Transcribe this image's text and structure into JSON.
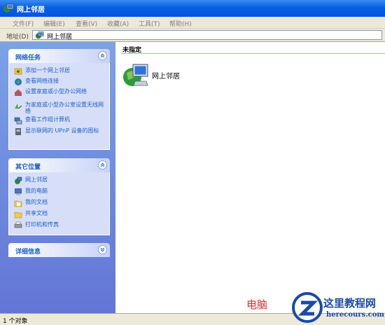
{
  "window": {
    "title": "网上邻居"
  },
  "menu": [
    "文件(F)",
    "编辑(E)",
    "查看(V)",
    "收藏(A)",
    "工具(T)",
    "帮助(H)"
  ],
  "address": {
    "label": "地址(D)",
    "value": "网上邻居"
  },
  "tasks_panel": {
    "title": "网络任务",
    "items": [
      {
        "label": "添加一个网上邻居",
        "icon": "add-network-place-icon"
      },
      {
        "label": "查看网络连接",
        "icon": "network-connections-icon"
      },
      {
        "label": "设置家庭或小型办公网络",
        "icon": "home-network-setup-icon"
      },
      {
        "label": "为家庭或小型办公室设置无线网络",
        "icon": "wireless-network-icon"
      },
      {
        "label": "查看工作组计算机",
        "icon": "workgroup-computers-icon"
      },
      {
        "label": "显示联网的 UPnP 设备的图标",
        "icon": "upnp-devices-icon"
      }
    ]
  },
  "places_panel": {
    "title": "其它位置",
    "items": [
      {
        "label": "网上邻居",
        "icon": "network-places-icon"
      },
      {
        "label": "我的电脑",
        "icon": "my-computer-icon"
      },
      {
        "label": "我的文档",
        "icon": "my-documents-icon"
      },
      {
        "label": "共享文档",
        "icon": "shared-documents-icon"
      },
      {
        "label": "打印机和传真",
        "icon": "printers-faxes-icon"
      }
    ]
  },
  "details_panel": {
    "title": "详细信息"
  },
  "content": {
    "group_header": "未指定",
    "items": [
      {
        "label": "网上邻居",
        "icon": "network-places-icon"
      }
    ]
  },
  "status": {
    "text": "1 个对象"
  },
  "watermark": {
    "text": "电脑",
    "site_cn": "这里教程网",
    "site_en": "herecours.com"
  },
  "colors": {
    "title_bar": "#0054e3",
    "left_pane": "#6b8ede",
    "panel_body": "#d6dff7",
    "link": "#215dc6",
    "watermark_red": "#e0282a",
    "watermark_blue": "#1a4aa8"
  }
}
